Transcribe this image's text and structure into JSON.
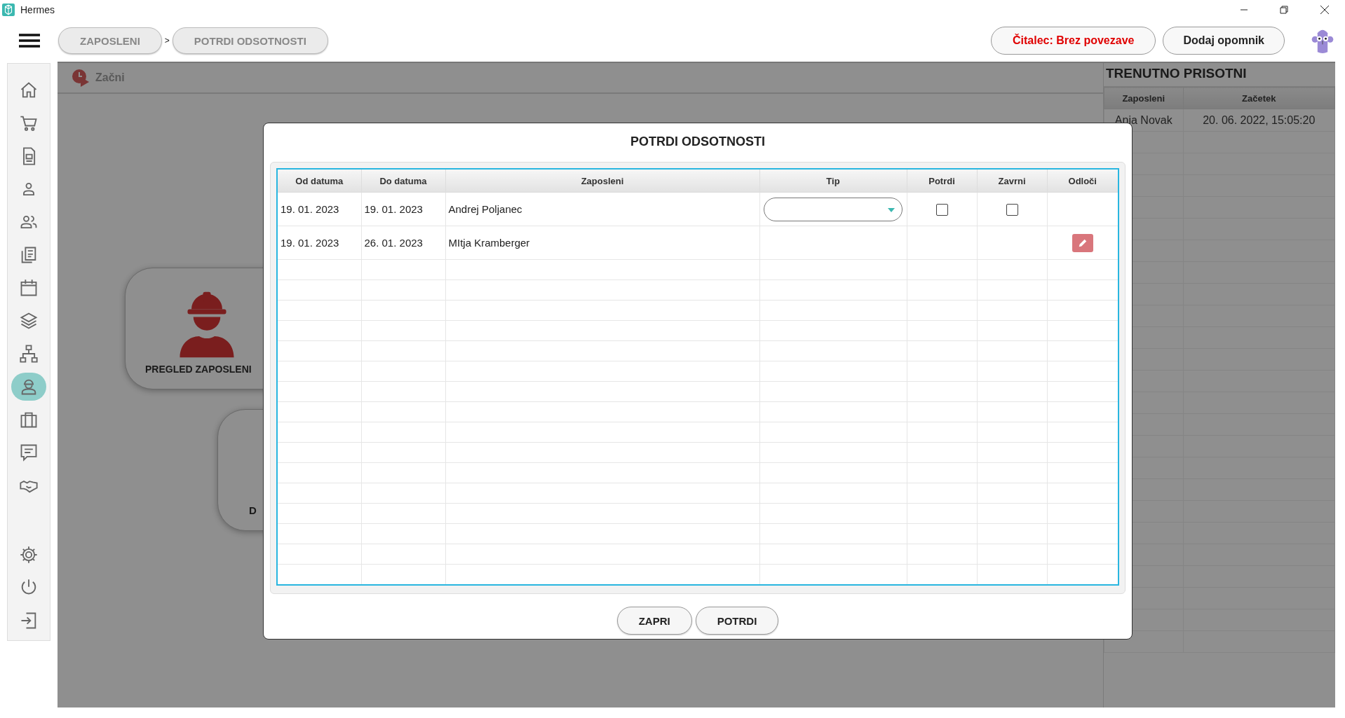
{
  "window": {
    "title": "Hermes"
  },
  "breadcrumbs": [
    {
      "label": "ZAPOSLENI"
    },
    {
      "label": "POTRDI ODSOTNOSTI"
    }
  ],
  "breadcrumb_separator": ">",
  "header_buttons": [
    {
      "label": "Čitalec: Brez povezave",
      "kind": "alert"
    },
    {
      "label": "Dodaj opomnik",
      "kind": "normal"
    }
  ],
  "sidebar": {
    "items": [
      {
        "selected": false
      },
      {
        "selected": false
      },
      {
        "selected": false
      },
      {
        "selected": false
      },
      {
        "selected": false
      },
      {
        "selected": false
      },
      {
        "selected": false
      },
      {
        "selected": false
      },
      {
        "selected": false
      },
      {
        "selected": true
      },
      {
        "selected": false
      },
      {
        "selected": false
      },
      {
        "selected": false
      }
    ],
    "bottom_items": [
      {
        "selected": false
      },
      {
        "selected": false
      },
      {
        "selected": false
      }
    ]
  },
  "main": {
    "start_label": "Začni",
    "cards": [
      {
        "label": "PREGLED ZAPOSLENI"
      },
      {
        "label": "D"
      }
    ]
  },
  "present_panel": {
    "title": "TRENUTNO PRISOTNI",
    "columns": [
      "Zaposleni",
      "Začetek"
    ],
    "rows": [
      [
        "Anja Novak",
        "20. 06. 2022, 15:05:20"
      ]
    ]
  },
  "dialog": {
    "title": "POTRDI ODSOTNOSTI",
    "columns": [
      "Od datuma",
      "Do datuma",
      "Zaposleni",
      "Tip",
      "Potrdi",
      "Zavrni",
      "Odloči"
    ],
    "rows": [
      {
        "kind": "pending",
        "from": "19. 01. 2023",
        "to": "19. 01. 2023",
        "employee": "Andrej Poljanec",
        "confirm": false,
        "reject": false
      },
      {
        "kind": "decided",
        "from": "19. 01. 2023",
        "to": "26. 01. 2023",
        "employee": "MItja Kramberger"
      }
    ],
    "buttons": [
      {
        "label": "ZAPRI"
      },
      {
        "label": "POTRDI"
      }
    ]
  }
}
